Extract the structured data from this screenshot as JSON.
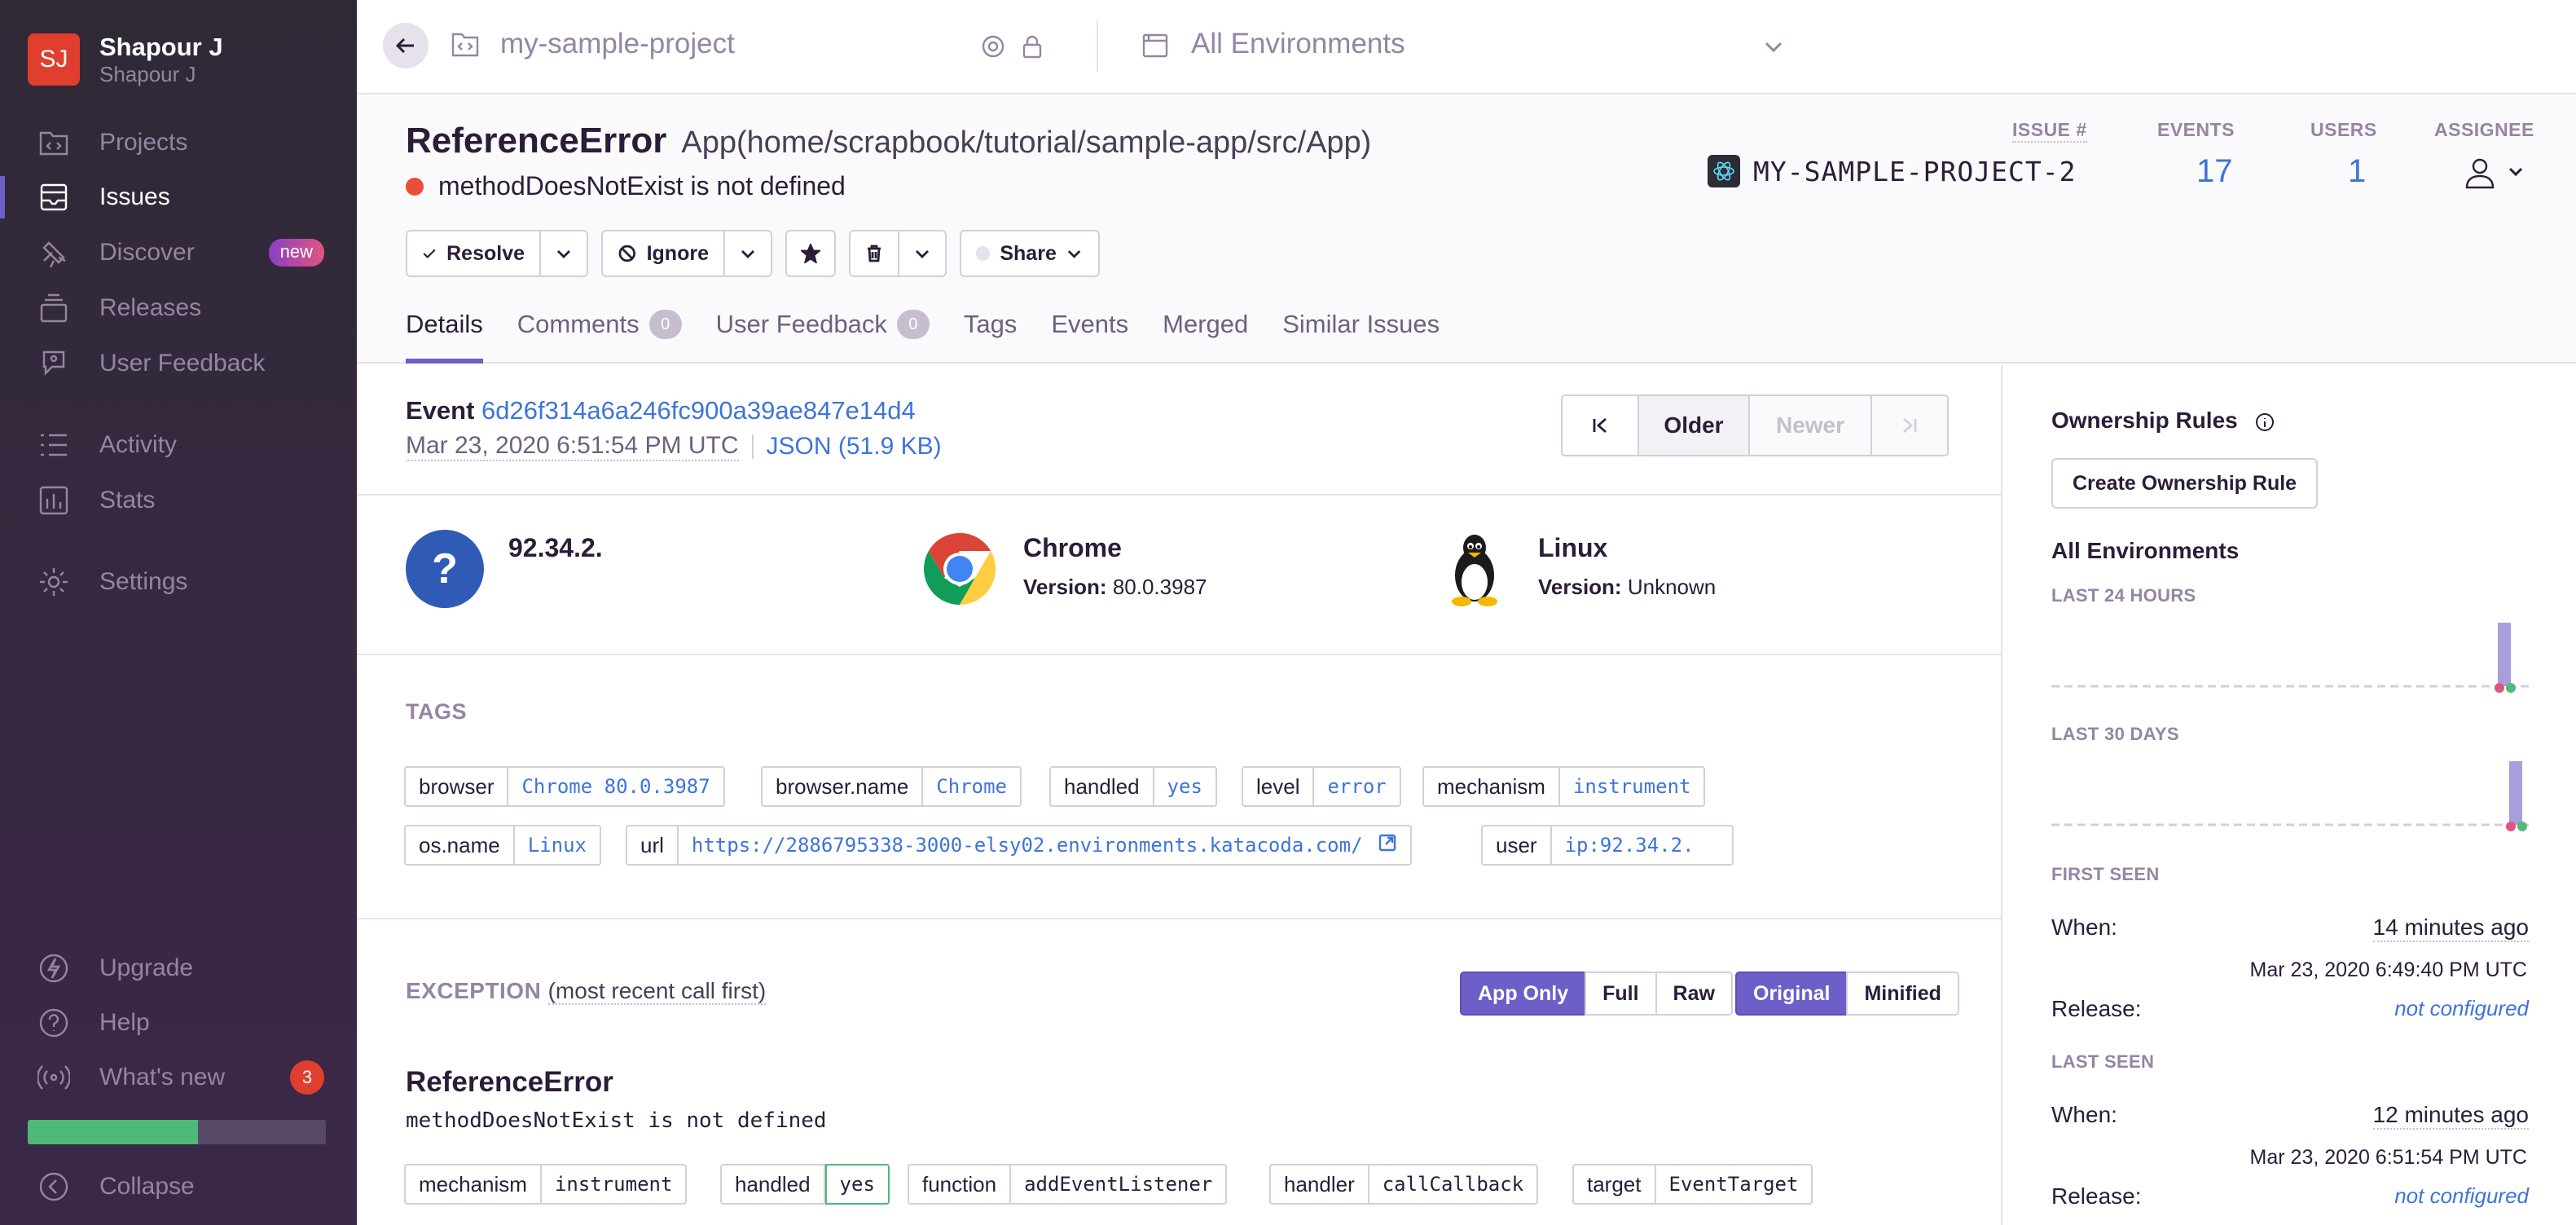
{
  "sidebar": {
    "org_initials": "SJ",
    "org_name": "Shapour J",
    "org_sub": "Shapour J",
    "items": [
      {
        "label": "Projects",
        "icon": "projects-icon"
      },
      {
        "label": "Issues",
        "icon": "issues-icon"
      },
      {
        "label": "Discover",
        "icon": "discover-icon",
        "badge": "new"
      },
      {
        "label": "Releases",
        "icon": "releases-icon"
      },
      {
        "label": "User Feedback",
        "icon": "user-feedback-icon"
      },
      {
        "label": "Activity",
        "icon": "activity-icon"
      },
      {
        "label": "Stats",
        "icon": "stats-icon"
      },
      {
        "label": "Settings",
        "icon": "settings-icon"
      }
    ],
    "bottom": [
      {
        "label": "Upgrade",
        "icon": "lightning-icon"
      },
      {
        "label": "Help",
        "icon": "help-icon"
      },
      {
        "label": "What's new",
        "icon": "broadcast-icon",
        "badge": "3"
      },
      {
        "label": "Collapse",
        "icon": "collapse-icon"
      }
    ],
    "onboarding_progress": 0.57
  },
  "topbar": {
    "project": "my-sample-project",
    "environment": "All Environments"
  },
  "issue": {
    "type": "ReferenceError",
    "location": "App(home/scrapbook/tutorial/sample-app/src/App)",
    "message": "methodDoesNotExist is not defined",
    "issue_label": "ISSUE #",
    "events_label": "EVENTS",
    "users_label": "USERS",
    "assignee_label": "ASSIGNEE",
    "short_id": "MY-SAMPLE-PROJECT-2",
    "events": "17",
    "users": "1"
  },
  "actions": {
    "resolve": "Resolve",
    "ignore": "Ignore",
    "share": "Share"
  },
  "tabs": [
    {
      "label": "Details"
    },
    {
      "label": "Comments",
      "count": "0"
    },
    {
      "label": "User Feedback",
      "count": "0"
    },
    {
      "label": "Tags"
    },
    {
      "label": "Events"
    },
    {
      "label": "Merged"
    },
    {
      "label": "Similar Issues"
    }
  ],
  "event": {
    "prefix": "Event",
    "id": "6d26f314a6a246fc900a39ae847e14d4",
    "date": "Mar 23, 2020 6:51:54 PM UTC",
    "json": "JSON (51.9 KB)",
    "older": "Older",
    "newer": "Newer"
  },
  "context": {
    "user": {
      "title": "92.34.2."
    },
    "browser": {
      "title": "Chrome",
      "version_label": "Version:",
      "version": "80.0.3987"
    },
    "os": {
      "title": "Linux",
      "version_label": "Version:",
      "version": "Unknown"
    }
  },
  "tags_section": {
    "title": "TAGS",
    "tags": [
      {
        "key": "browser",
        "value": "Chrome 80.0.3987"
      },
      {
        "key": "browser.name",
        "value": "Chrome"
      },
      {
        "key": "handled",
        "value": "yes"
      },
      {
        "key": "level",
        "value": "error"
      },
      {
        "key": "mechanism",
        "value": "instrument"
      },
      {
        "key": "os.name",
        "value": "Linux"
      },
      {
        "key": "url",
        "value": "https://2886795338-3000-elsy02.environments.katacoda.com/"
      },
      {
        "key": "user",
        "value": "ip:92.34.2."
      }
    ]
  },
  "exception": {
    "title": "EXCEPTION",
    "subtitle": "(most recent call first)",
    "toggle1": [
      "App Only",
      "Full",
      "Raw"
    ],
    "toggle2": [
      "Original",
      "Minified"
    ],
    "type": "ReferenceError",
    "message": "methodDoesNotExist is not defined",
    "mechanism": [
      {
        "key": "mechanism",
        "value": "instrument"
      },
      {
        "key": "handled",
        "value": "yes"
      },
      {
        "key": "function",
        "value": "addEventListener"
      },
      {
        "key": "handler",
        "value": "callCallback"
      },
      {
        "key": "target",
        "value": "EventTarget"
      }
    ]
  },
  "sidebar_right": {
    "ownership_title": "Ownership Rules",
    "create_rule": "Create Ownership Rule",
    "env_title": "All Environments",
    "last24": "LAST 24 HOURS",
    "last30": "LAST 30 DAYS",
    "first_seen": "FIRST SEEN",
    "last_seen": "LAST SEEN",
    "when_label": "When:",
    "release_label": "Release:",
    "first_when": "14 minutes ago",
    "first_date": "Mar 23, 2020 6:49:40 PM UTC",
    "first_release": "not configured",
    "last_when": "12 minutes ago",
    "last_date": "Mar 23, 2020 6:51:54 PM UTC",
    "last_release": "not configured"
  },
  "colors": {
    "accent": "#6c5fc7",
    "link": "#3d74db",
    "error": "#e94f37",
    "sidebar": "#2f2936"
  }
}
